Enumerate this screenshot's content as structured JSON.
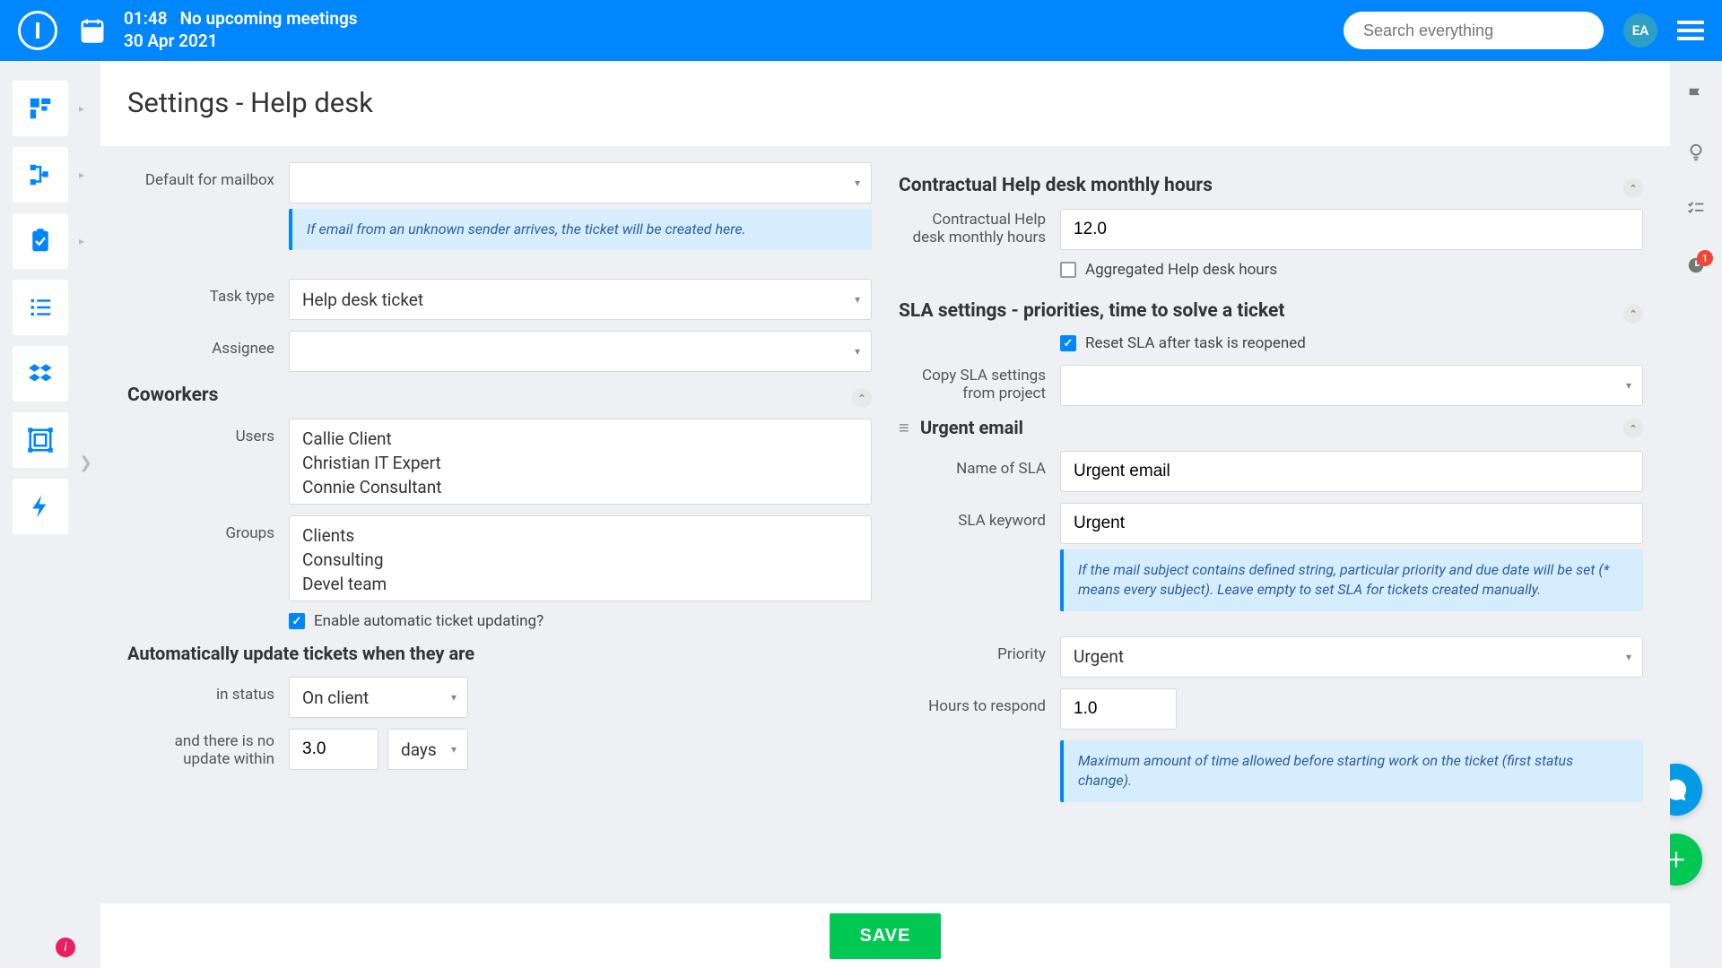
{
  "header": {
    "time": "01:48",
    "meetings": "No upcoming meetings",
    "date": "30 Apr 2021",
    "search_placeholder": "Search everything",
    "avatar_initials": "EA"
  },
  "page_title": "Settings - Help desk",
  "left": {
    "default_mailbox_label": "Default for mailbox",
    "default_mailbox_value": "",
    "mailbox_info": "If email from an unknown sender arrives, the ticket will be created here.",
    "task_type_label": "Task type",
    "task_type_value": "Help desk ticket",
    "assignee_label": "Assignee",
    "assignee_value": "",
    "coworkers_title": "Coworkers",
    "users_label": "Users",
    "users": [
      "Callie Client",
      "Christian IT Expert",
      "Connie Consultant"
    ],
    "groups_label": "Groups",
    "groups": [
      "Clients",
      "Consulting",
      "Devel team"
    ],
    "enable_auto_label": "Enable automatic ticket updating?",
    "auto_update_title": "Automatically update tickets when they are",
    "in_status_label": "in status",
    "in_status_value": "On client",
    "no_update_label": "and there is no update within",
    "no_update_value": "3.0",
    "no_update_unit": "days"
  },
  "right": {
    "contractual_title": "Contractual Help desk monthly hours",
    "contractual_label": "Contractual Help desk monthly hours",
    "contractual_value": "12.0",
    "aggregated_label": "Aggregated Help desk hours",
    "sla_title": "SLA settings - priorities, time to solve a ticket",
    "reset_sla_label": "Reset SLA after task is reopened",
    "copy_sla_label": "Copy SLA settings from project",
    "copy_sla_value": "",
    "urgent_subtitle": "Urgent email",
    "name_sla_label": "Name of SLA",
    "name_sla_value": "Urgent email",
    "sla_keyword_label": "SLA keyword",
    "sla_keyword_value": "Urgent",
    "keyword_info": "If the mail subject contains defined string, particular priority and due date will be set (* means every subject). Leave empty to set SLA for tickets created manually.",
    "priority_label": "Priority",
    "priority_value": "Urgent",
    "hours_respond_label": "Hours to respond",
    "hours_respond_value": "1.0",
    "respond_info": "Maximum amount of time allowed before starting work on the ticket (first status change)."
  },
  "save_label": "SAVE",
  "notif_count": "1"
}
